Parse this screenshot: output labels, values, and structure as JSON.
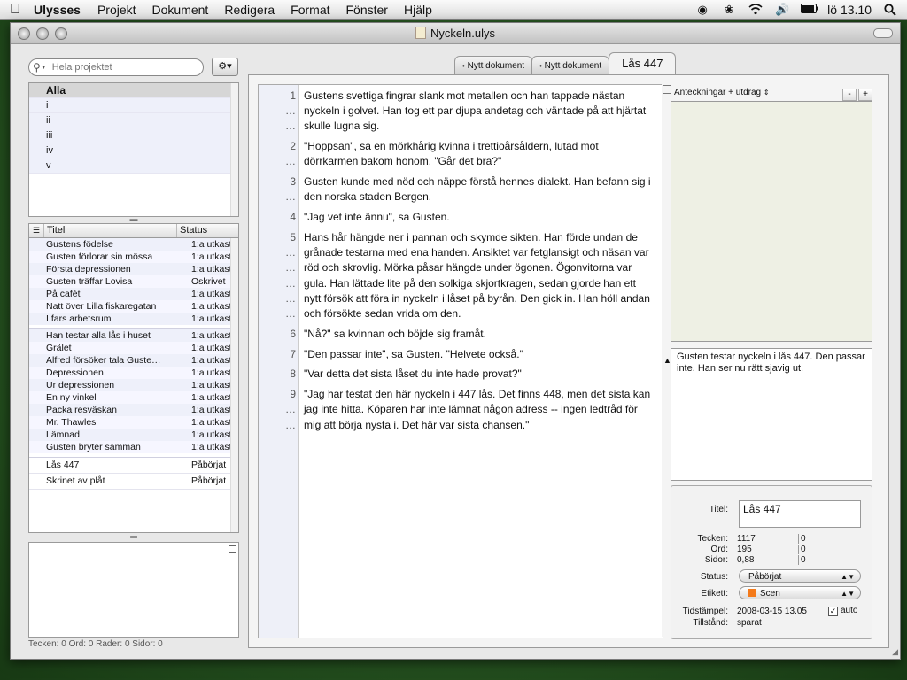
{
  "menubar": {
    "app": "Ulysses",
    "items": [
      "Projekt",
      "Dokument",
      "Redigera",
      "Format",
      "Fönster",
      "Hjälp"
    ],
    "clock": "lö 13.10",
    "icons": [
      "apple-icon",
      "app-status-icon",
      "growl-icon",
      "wifi-icon",
      "volume-icon",
      "battery-icon",
      "spotlight-icon"
    ]
  },
  "window": {
    "title": "Nyckeln.ulys"
  },
  "search": {
    "placeholder": "Hela projektet"
  },
  "groups": [
    "Alla",
    "i",
    "ii",
    "iii",
    "iv",
    "v"
  ],
  "sheets": {
    "col_title": "Titel",
    "col_status": "Status",
    "block1": [
      {
        "title": "Gustens födelse",
        "status": "1:a utkast"
      },
      {
        "title": "Gusten förlorar sin mössa",
        "status": "1:a utkast"
      },
      {
        "title": "Första depressionen",
        "status": "1:a utkast"
      },
      {
        "title": "Gusten träffar Lovisa",
        "status": "Oskrivet"
      },
      {
        "title": "På cafét",
        "status": "1:a utkast"
      },
      {
        "title": "Natt över Lilla fiskaregatan",
        "status": "1:a utkast"
      },
      {
        "title": "I fars arbetsrum",
        "status": "1:a utkast"
      }
    ],
    "block2": [
      {
        "title": "Han testar alla lås i huset",
        "status": "1:a utkast"
      },
      {
        "title": "Grälet",
        "status": "1:a utkast"
      },
      {
        "title": "Alfred försöker tala Guste…",
        "status": "1:a utkast"
      },
      {
        "title": "Depressionen",
        "status": "1:a utkast"
      },
      {
        "title": "Ur depressionen",
        "status": "1:a utkast"
      },
      {
        "title": "En ny vinkel",
        "status": "1:a utkast"
      },
      {
        "title": "Packa resväskan",
        "status": "1:a utkast"
      },
      {
        "title": "Mr. Thawles",
        "status": "1:a utkast"
      },
      {
        "title": "Lämnad",
        "status": "1:a utkast"
      },
      {
        "title": "Gusten bryter samman",
        "status": "1:a utkast"
      }
    ],
    "block3": [
      {
        "title": "Lås 447",
        "status": "Påbörjat"
      },
      {
        "title": "Skrinet av plåt",
        "status": "Påbörjat"
      }
    ]
  },
  "statusline": "Tecken: 0  Ord: 0  Rader: 0  Sidor: 0",
  "tabs": [
    "Nytt dokument",
    "Nytt dokument",
    "Lås 447"
  ],
  "tab_dot": "•",
  "editor": {
    "continuation": "…",
    "paragraphs": [
      {
        "n": "1",
        "lines": 3,
        "text": "Gustens svettiga fingrar slank mot metallen och han tappade nästan nyckeln i golvet. Han tog ett par djupa andetag och väntade på att hjärtat skulle lugna sig."
      },
      {
        "n": "2",
        "lines": 2,
        "text": "\"Hoppsan\", sa en mörkhårig kvinna i trettioårsåldern, lutad mot dörrkarmen bakom honom. \"Går det bra?\""
      },
      {
        "n": "3",
        "lines": 2,
        "text": "Gusten kunde med nöd och näppe förstå hennes dialekt. Han befann sig i den norska staden Bergen."
      },
      {
        "n": "4",
        "lines": 1,
        "text": "\"Jag vet inte ännu\", sa Gusten."
      },
      {
        "n": "5",
        "lines": 6,
        "text": "Hans hår hängde ner i pannan och skymde sikten. Han förde undan de grånade testarna med ena handen. Ansiktet var fetglansigt och näsan var röd och skrovlig. Mörka påsar hängde under ögonen. Ögonvitorna var gula. Han lättade lite på den solkiga skjortkragen, sedan gjorde han ett nytt försök att föra in nyckeln i låset på byrån. Den gick in. Han höll andan och försökte sedan vrida om den."
      },
      {
        "n": "6",
        "lines": 1,
        "text": "\"Nå?\" sa kvinnan och böjde sig framåt."
      },
      {
        "n": "7",
        "lines": 1,
        "text": "\"Den passar inte\", sa Gusten. \"Helvete också.\""
      },
      {
        "n": "8",
        "lines": 1,
        "text": "\"Var detta det sista låset du inte hade provat?\""
      },
      {
        "n": "9",
        "lines": 3,
        "text": "\"Jag har testat den här nyckeln i 447 lås. Det finns 448, men det sista kan jag inte hitta. Köparen har inte lämnat någon adress -- ingen ledtråd för mig att börja nysta i. Det här var sista chansen.\""
      }
    ]
  },
  "notes": {
    "header": "Anteckningar + utdrag",
    "minus": "-",
    "plus": "+",
    "excerpt": "Gusten testar nyckeln i lås 447. Den passar inte. Han ser nu rätt sjavig ut."
  },
  "info": {
    "title_label": "Titel:",
    "title_value": "Lås 447",
    "chars_label": "Tecken:",
    "chars": "1117",
    "chars2": "0",
    "words_label": "Ord:",
    "words": "195",
    "words2": "0",
    "pages_label": "Sidor:",
    "pages": "0,88",
    "pages2": "0",
    "status_label": "Status:",
    "status_value": "Påbörjat",
    "tag_label": "Etikett:",
    "tag_value": "Scen",
    "tag_color": "#f47a1a",
    "timestamp_label": "Tidstämpel:",
    "timestamp": "2008-03-15 13.05",
    "auto_label": "auto",
    "auto_checked": true,
    "state_label": "Tillstånd:",
    "state": "sparat"
  }
}
